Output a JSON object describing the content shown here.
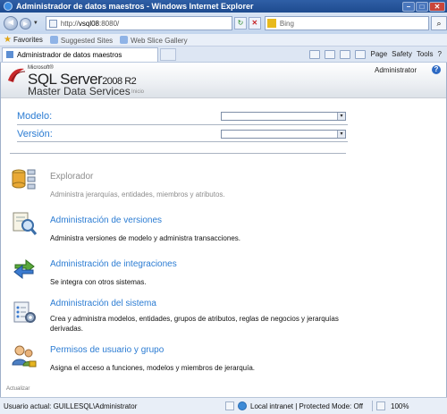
{
  "window": {
    "title": "Administrador de datos maestros - Windows Internet Explorer",
    "min_glyph": "–",
    "max_glyph": "□",
    "close_glyph": "✕"
  },
  "browser": {
    "back_glyph": "◄",
    "forward_glyph": "►",
    "dropdown_glyph": "▼",
    "address_prefix": "http://",
    "address_host": "vsql08",
    "address_rest": ":8080/",
    "refresh_glyph": "↻",
    "stop_glyph": "✕",
    "search_placeholder": "Bing",
    "search_glyph": "⌕",
    "favorites_label": "Favorites",
    "suggested_sites": "Suggested Sites",
    "web_slice_gallery": "Web Slice Gallery",
    "tab_title": "Administrador de datos maestros",
    "cmd_page": "Page",
    "cmd_safety": "Safety",
    "cmd_tools": "Tools",
    "cmd_help": "?"
  },
  "header": {
    "microsoft_label": "Microsoft®",
    "product": "SQL Server",
    "version": "2008 R2",
    "subtitle": "Master Data Services",
    "breadcrumb": "Inicio",
    "user": "Administrator",
    "help": "?"
  },
  "filters": {
    "model_label": "Modelo:",
    "version_label": "Versión:",
    "select_arrow": "▾"
  },
  "sections": [
    {
      "title": "Explorador",
      "description": "Administra jerarquías, entidades, miembros y atributos.",
      "enabled": false,
      "icon": "explorer-icon"
    },
    {
      "title": "Administración de versiones",
      "description": "Administra versiones de modelo y administra transacciones.",
      "enabled": true,
      "icon": "version-management-icon"
    },
    {
      "title": "Administración de integraciones",
      "description": "Se integra con otros sistemas.",
      "enabled": true,
      "icon": "integration-icon"
    },
    {
      "title": "Administración del sistema",
      "description": "Crea y administra modelos, entidades, grupos de atributos, reglas de negocios y jerarquías derivadas.",
      "enabled": true,
      "icon": "system-admin-icon"
    },
    {
      "title": "Permisos de usuario y grupo",
      "description": "Asigna el acceso a funciones, modelos y miembros de jerarquía.",
      "enabled": true,
      "icon": "user-permissions-icon"
    }
  ],
  "footer": {
    "refresh_label": "Actualizar"
  },
  "status": {
    "user": "Usuario actual: GUILLESQL\\Administrator",
    "zone": "Local intranet | Protected Mode: Off",
    "zoom": "100%"
  },
  "colors": {
    "accent": "#2b7cd3",
    "disabled": "#8c8c8c",
    "titlebar": "#1e4b8f"
  }
}
